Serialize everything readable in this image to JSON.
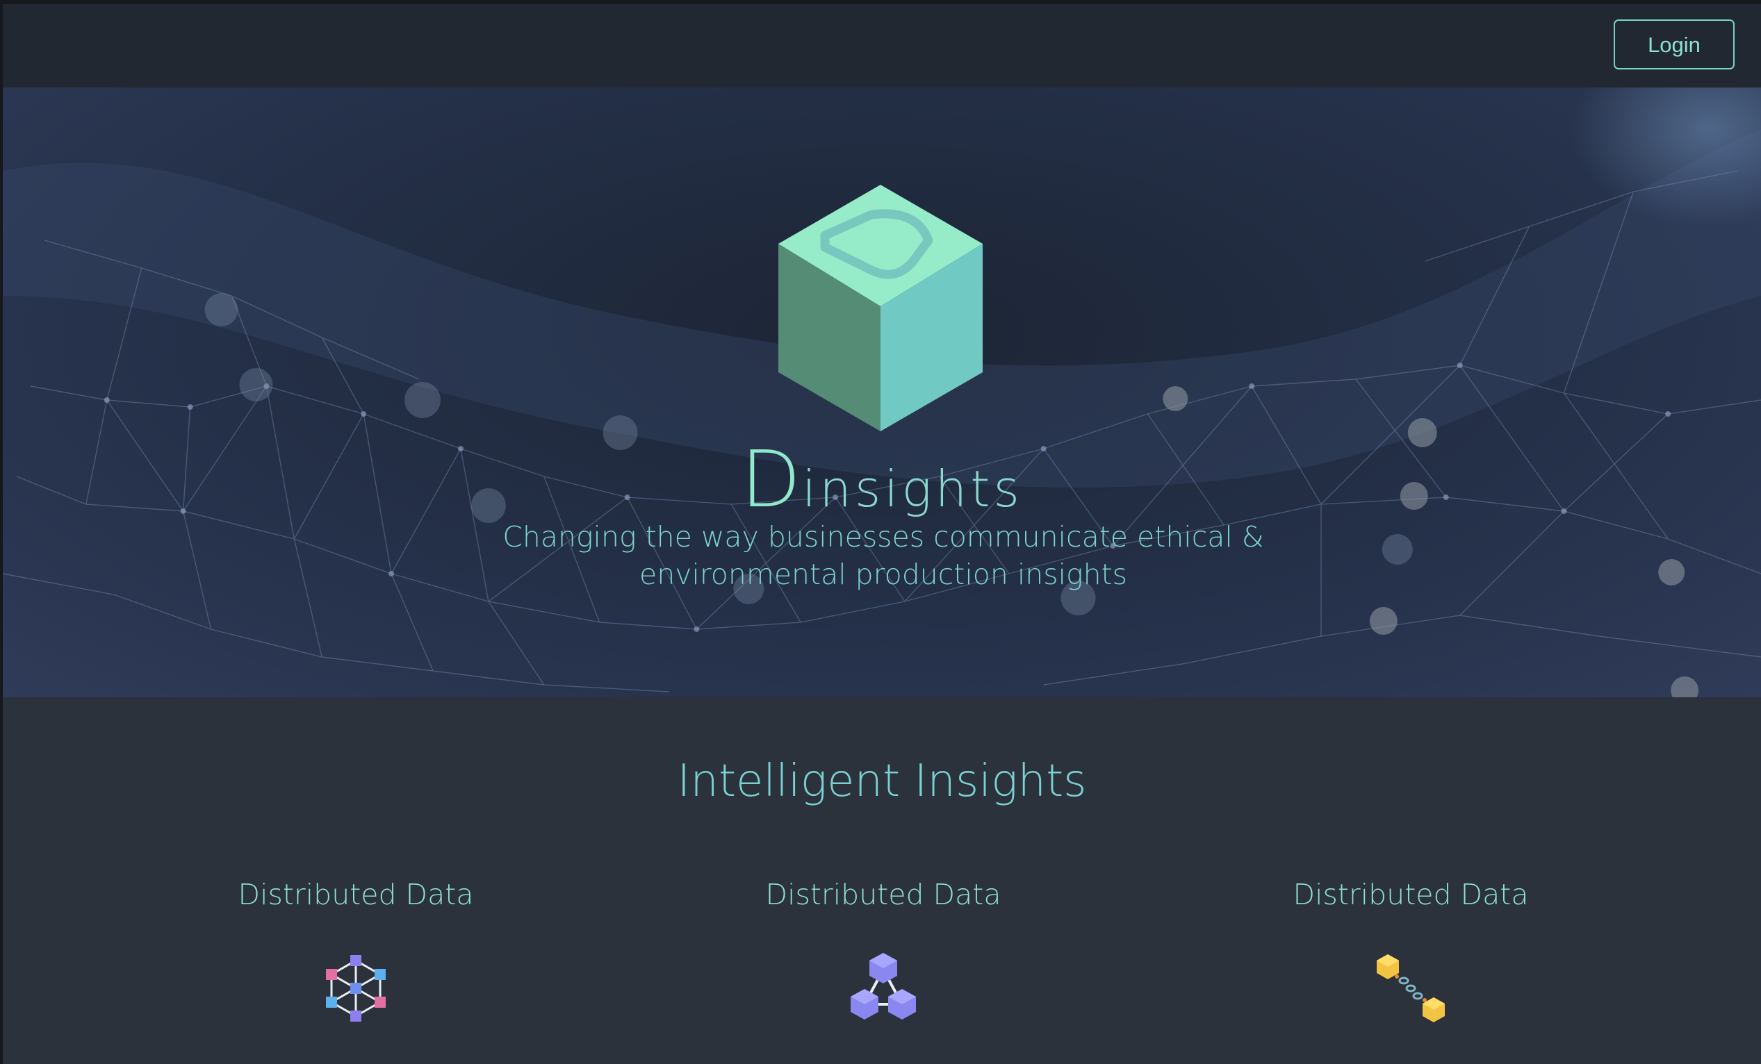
{
  "navbar": {
    "login_label": "Login"
  },
  "hero": {
    "brand_letter": "D",
    "brand_word": "insights",
    "tagline": "Changing the way businesses communicate ethical & environmental production insights"
  },
  "features": {
    "title": "Intelligent Insights",
    "cards": [
      {
        "title": "Distributed Data",
        "icon": "molecule-network-icon"
      },
      {
        "title": "Distributed Data",
        "icon": "cube-triangle-network-icon"
      },
      {
        "title": "Distributed Data",
        "icon": "cube-chain-link-icon"
      }
    ]
  },
  "colors": {
    "accent": "#8ee0d0",
    "navbar_bg": "#222831",
    "page_bg": "#2b323b",
    "hero_bg": "#243048"
  }
}
